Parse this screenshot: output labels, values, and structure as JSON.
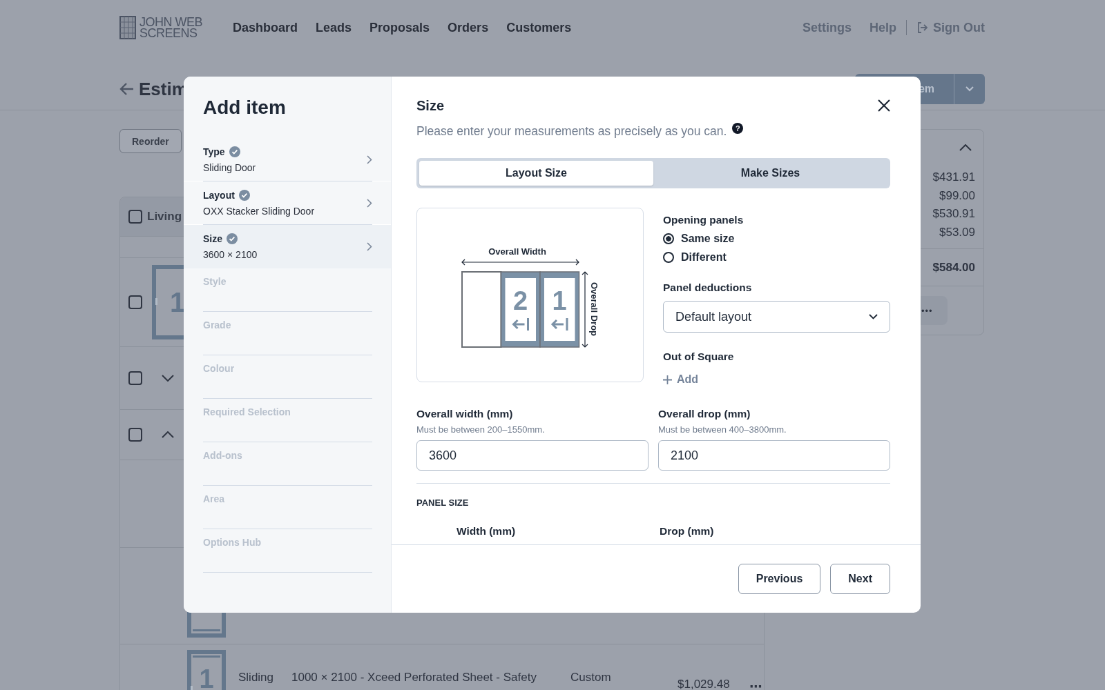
{
  "header": {
    "logo": [
      "JOHN WEB",
      "SCREENS"
    ],
    "nav": [
      {
        "label": "Dashboard",
        "selected": false
      },
      {
        "label": "Leads",
        "selected": false
      },
      {
        "label": "Proposals",
        "selected": false
      },
      {
        "label": "Orders",
        "selected": false
      },
      {
        "label": "Customers",
        "selected": false
      }
    ],
    "links": [
      "Settings",
      "Help"
    ],
    "sign_out": "Sign Out"
  },
  "page": {
    "title": "Estim",
    "add_button": "em",
    "reorder": "Reorder"
  },
  "table": {
    "group": "Living",
    "group_checked": false,
    "rows": [
      {
        "kind": "door",
        "checked": false,
        "panel_number": "1"
      },
      {
        "kind": "group",
        "checked": false,
        "expanded": false
      },
      {
        "kind": "group",
        "checked": false,
        "expanded": true
      },
      {
        "kind": "blank"
      },
      {
        "kind": "door-bottom"
      },
      {
        "kind": "item",
        "panel_number": "1",
        "type": "Sliding",
        "description": "1000 × 2100 - Xceed Perforated Sheet - Safety",
        "column_4": "Custom",
        "price": "$1,029.48",
        "menu": "⋯"
      }
    ]
  },
  "summary": {
    "expanded": true,
    "amounts": [
      "$431.91",
      "$99.00",
      "$530.91",
      "$53.09"
    ],
    "total": "$584.00",
    "menu": "•••"
  },
  "modal": {
    "title": "Add item",
    "steps": [
      {
        "label": "Type",
        "value": "Sliding Door",
        "complete": true,
        "selected": false
      },
      {
        "label": "Layout",
        "value": "OXX Stacker Sliding Door",
        "complete": true,
        "selected": false
      },
      {
        "label": "Size",
        "value": "3600 × 2100",
        "complete": true,
        "selected": true
      },
      {
        "label": "Style",
        "complete": false,
        "selected": false
      },
      {
        "label": "Grade",
        "complete": false,
        "selected": false
      },
      {
        "label": "Colour",
        "complete": false,
        "selected": false
      },
      {
        "label": "Required Selection",
        "complete": false,
        "selected": false
      },
      {
        "label": "Add-ons",
        "complete": false,
        "selected": false
      },
      {
        "label": "Area",
        "complete": false,
        "selected": false
      },
      {
        "label": "Options Hub",
        "complete": false,
        "selected": false
      }
    ],
    "section_title": "Size",
    "intro": "Please enter your measurements as precisely as you can.",
    "help": "?",
    "tabs": [
      {
        "label": "Layout Size",
        "selected": true
      },
      {
        "label": "Make Sizes",
        "selected": false
      }
    ],
    "diagram": {
      "width_label": "Overall Width",
      "drop_label": "Overall Drop",
      "panels": [
        {
          "kind": "fixed"
        },
        {
          "kind": "sliding",
          "number": "2"
        },
        {
          "kind": "sliding",
          "number": "1"
        }
      ]
    },
    "opening_panels": {
      "label": "Opening panels",
      "options": [
        {
          "label": "Same size",
          "selected": true
        },
        {
          "label": "Different",
          "selected": false
        }
      ]
    },
    "panel_deductions": {
      "label": "Panel deductions",
      "value": "Default layout"
    },
    "out_of_square": {
      "label": "Out of Square",
      "action": "Add"
    },
    "fields": [
      {
        "label": "Overall width (mm)",
        "hint": "Must be between 200–1550mm.",
        "value": "3600"
      },
      {
        "label": "Overall drop (mm)",
        "hint": "Must be between 400–3800mm.",
        "value": "2100"
      }
    ],
    "panel_size": {
      "heading": "PANEL SIZE",
      "columns": [
        "Width (mm)",
        "Drop (mm)"
      ]
    },
    "buttons": [
      "Previous",
      "Next"
    ]
  }
}
